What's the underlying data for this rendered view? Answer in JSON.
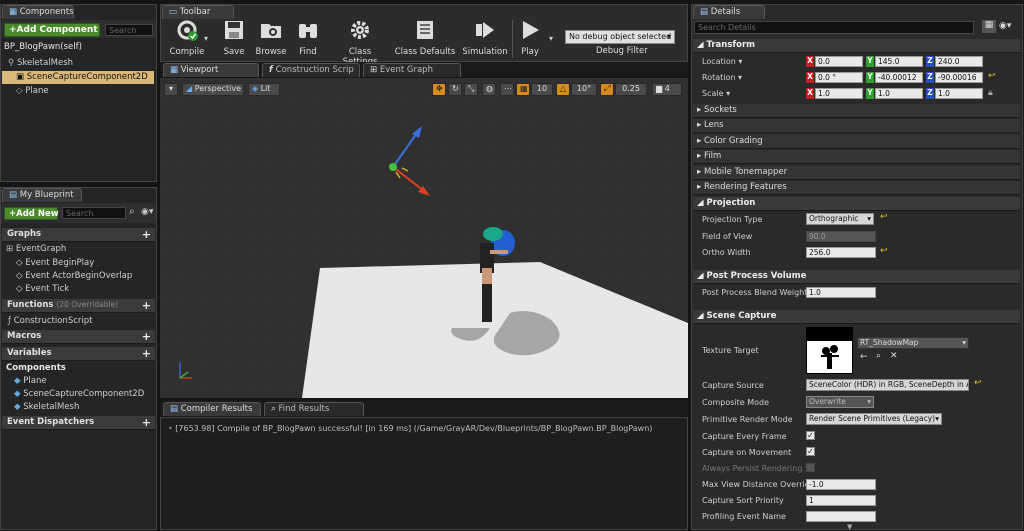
{
  "components_panel": {
    "tab": "Components",
    "add_button": "+Add Component",
    "search_placeholder": "Search",
    "root": "BP_BlogPawn(self)",
    "items": [
      "SkeletalMesh",
      "SceneCaptureComponent2D",
      "Plane"
    ]
  },
  "toolbar": {
    "tab": "Toolbar",
    "buttons": [
      {
        "label": "Compile"
      },
      {
        "label": "Save"
      },
      {
        "label": "Browse"
      },
      {
        "label": "Find"
      },
      {
        "label": "Class Settings"
      },
      {
        "label": "Class Defaults"
      },
      {
        "label": "Simulation"
      },
      {
        "label": "Play"
      }
    ],
    "debug_select": "No debug object selected",
    "debug_filter_label": "Debug Filter"
  },
  "editor_tabs": [
    "Viewport",
    "Construction Scrip",
    "Event Graph"
  ],
  "viewport": {
    "perspective": "Perspective",
    "lit": "Lit",
    "grid_snap": "10",
    "rot_snap": "10°",
    "scale_snap": "0.25",
    "camera_speed": "4"
  },
  "my_blueprint": {
    "tab": "My Blueprint",
    "add_new": "+Add New",
    "search_placeholder": "Search",
    "graphs_header": "Graphs",
    "event_graph": "EventGraph",
    "events": [
      "Event BeginPlay",
      "Event ActorBeginOverlap",
      "Event Tick"
    ],
    "functions_header": "Functions",
    "functions_count": "(20 Overridable)",
    "functions": [
      "ConstructionScript"
    ],
    "macros_header": "Macros",
    "variables_header": "Variables",
    "components_header": "Components",
    "components": [
      "Plane",
      "SceneCaptureComponent2D",
      "SkeletalMesh"
    ],
    "dispatchers_header": "Event Dispatchers"
  },
  "bottom": {
    "tabs": [
      "Compiler Results",
      "Find Results"
    ],
    "log": "[7653.98] Compile of BP_BlogPawn successful! [in 169 ms] (/Game/GrayAR/Dev/Blueprints/BP_BlogPawn.BP_BlogPawn)"
  },
  "details": {
    "tab": "Details",
    "search_placeholder": "Search Details",
    "transform": "Transform",
    "location_label": "Location",
    "location": [
      "0.0",
      "145.0",
      "240.0"
    ],
    "rotation_label": "Rotation",
    "rotation": [
      "0.0 °",
      "-40.00012",
      "-90.00016"
    ],
    "scale_label": "Scale",
    "scale": [
      "1.0",
      "1.0",
      "1.0"
    ],
    "collapsed": [
      "Sockets",
      "Lens",
      "Color Grading",
      "Film",
      "Mobile Tonemapper",
      "Rendering Features"
    ],
    "projection": "Projection",
    "projection_type_label": "Projection Type",
    "projection_type": "Orthographic",
    "fov_label": "Field of View",
    "fov": "90.0",
    "ortho_label": "Ortho Width",
    "ortho": "256.0",
    "ppv": "Post Process Volume",
    "ppbw_label": "Post Process Blend Weight",
    "ppbw": "1.0",
    "scene_capture": "Scene Capture",
    "texture_target_label": "Texture Target",
    "texture_target": "RT_ShadowMap",
    "capture_source_label": "Capture Source",
    "capture_source": "SceneColor (HDR) in RGB, SceneDepth in A",
    "composite_label": "Composite Mode",
    "composite": "Overwrite",
    "prim_label": "Primitive Render Mode",
    "prim": "Render Scene Primitives (Legacy)",
    "cef_label": "Capture Every Frame",
    "com_label": "Capture on Movement",
    "apr_label": "Always Persist Rendering St",
    "mvdo_label": "Max View Distance Override",
    "mvdo": "-1.0",
    "csp_label": "Capture Sort Priority",
    "csp": "1",
    "pen_label": "Profiling Event Name"
  }
}
